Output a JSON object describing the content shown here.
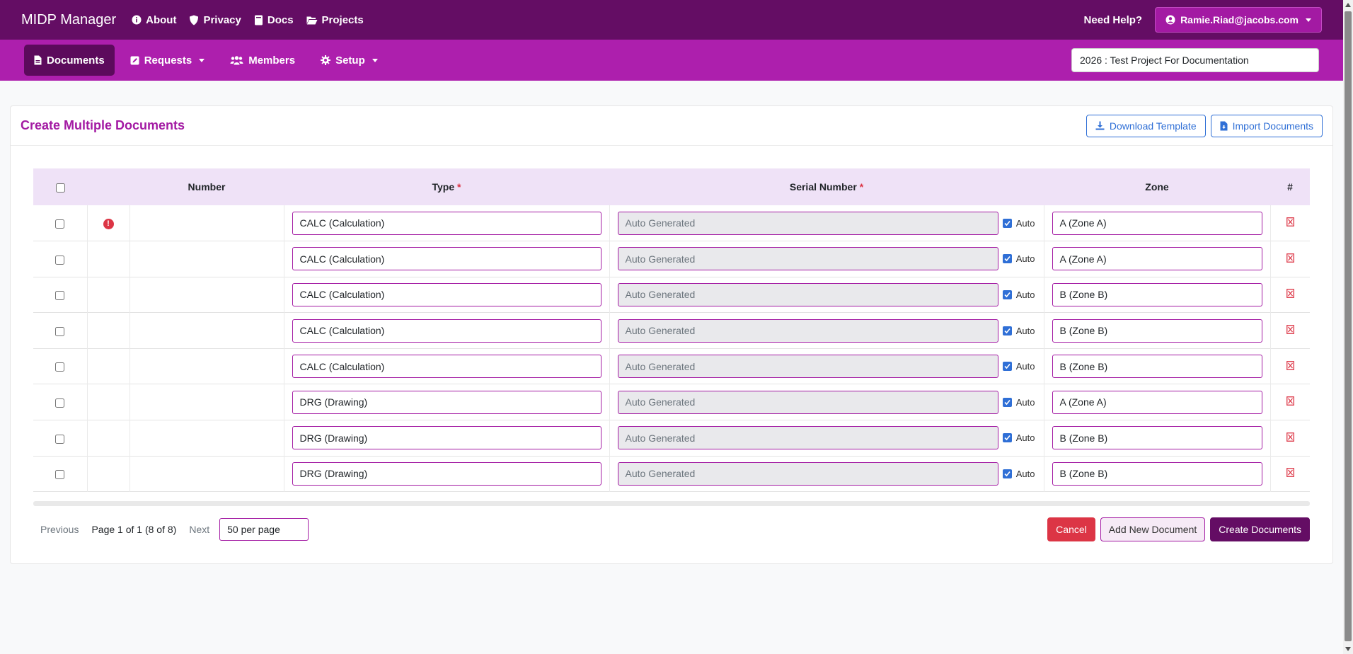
{
  "nav": {
    "brand": "MIDP Manager",
    "links": {
      "about": "About",
      "privacy": "Privacy",
      "docs": "Docs",
      "projects": "Projects"
    },
    "help": "Need Help?",
    "user": "Ramie.Riad@jacobs.com"
  },
  "subnav": {
    "documents": "Documents",
    "requests": "Requests",
    "members": "Members",
    "setup": "Setup",
    "project": "2026 : Test Project For Documentation"
  },
  "page": {
    "title": "Create Multiple Documents",
    "download_template": "Download Template",
    "import_documents": "Import Documents"
  },
  "table": {
    "headers": {
      "number": "Number",
      "type": "Type",
      "required": "*",
      "serial": "Serial Number",
      "zone": "Zone",
      "hash": "#"
    },
    "auto_label": "Auto",
    "rows": [
      {
        "error": "!",
        "number": "",
        "type": "CALC (Calculation)",
        "serial": "Auto Generated",
        "zone": "A (Zone A)"
      },
      {
        "error": "",
        "number": "",
        "type": "CALC (Calculation)",
        "serial": "Auto Generated",
        "zone": "A (Zone A)"
      },
      {
        "error": "",
        "number": "",
        "type": "CALC (Calculation)",
        "serial": "Auto Generated",
        "zone": "B (Zone B)"
      },
      {
        "error": "",
        "number": "",
        "type": "CALC (Calculation)",
        "serial": "Auto Generated",
        "zone": "B (Zone B)"
      },
      {
        "error": "",
        "number": "",
        "type": "CALC (Calculation)",
        "serial": "Auto Generated",
        "zone": "B (Zone B)"
      },
      {
        "error": "",
        "number": "",
        "type": "DRG (Drawing)",
        "serial": "Auto Generated",
        "zone": "A (Zone A)"
      },
      {
        "error": "",
        "number": "",
        "type": "DRG (Drawing)",
        "serial": "Auto Generated",
        "zone": "B (Zone B)"
      },
      {
        "error": "",
        "number": "",
        "type": "DRG (Drawing)",
        "serial": "Auto Generated",
        "zone": "B (Zone B)"
      }
    ]
  },
  "pagination": {
    "previous": "Previous",
    "info": "Page 1 of 1 (8 of 8)",
    "next": "Next",
    "per_page": "50 per page"
  },
  "actions": {
    "cancel": "Cancel",
    "add": "Add New Document",
    "create": "Create Documents"
  },
  "colors": {
    "primary_dark": "#640d64",
    "primary": "#ad1fad",
    "accent_blue": "#2f6fd6",
    "danger": "#dc3545"
  }
}
